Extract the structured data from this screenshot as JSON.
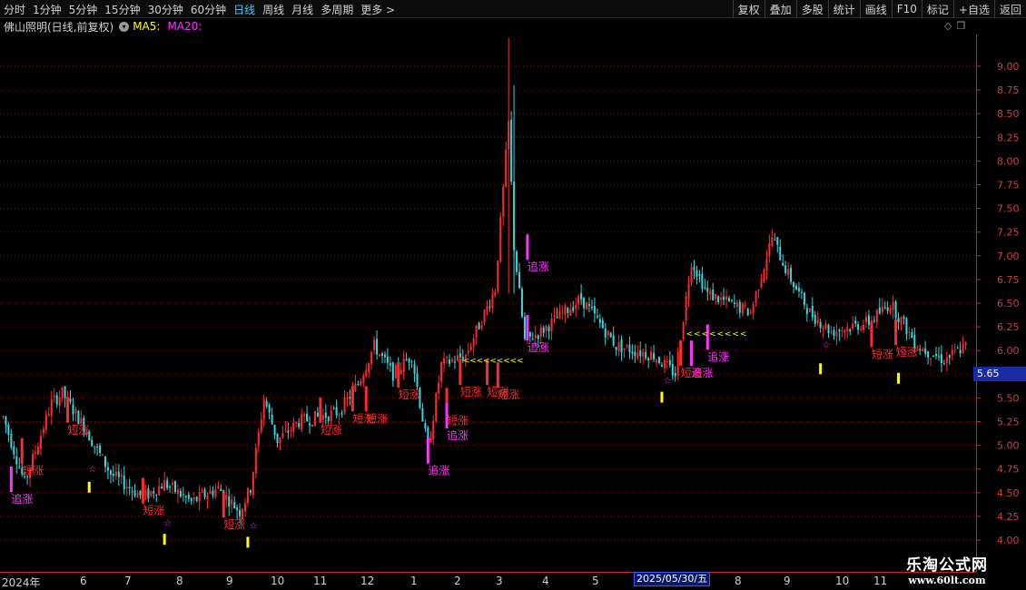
{
  "toolbar": {
    "periods": [
      "分时",
      "1分钟",
      "5分钟",
      "15分钟",
      "30分钟",
      "60分钟",
      "日线",
      "周线",
      "月线",
      "多周期",
      "更多 >"
    ],
    "active_period": "日线",
    "actions": [
      "复权",
      "叠加",
      "多股",
      "统计",
      "画线",
      "F10",
      "标记",
      "+自选",
      "返回"
    ]
  },
  "infobar": {
    "title": "佛山照明(日线,前复权)",
    "ma5_label": "MA5:",
    "ma20_label": "MA20:"
  },
  "current_price_label": "5.65",
  "date_cursor": "2025/05/30/五",
  "watermark": {
    "name": "乐淘公式网",
    "url": "www.60lt.com"
  },
  "colors": {
    "up": "#ff2a2a",
    "down": "#34d8e0",
    "signal_magenta": "#ff33ff",
    "signal_yellow": "#ffff00",
    "grid": "#7a1010"
  },
  "chart_data": {
    "type": "candlestick",
    "y_ticks": [
      "9.00",
      "8.75",
      "8.50",
      "8.25",
      "8.00",
      "7.75",
      "7.50",
      "7.25",
      "7.00",
      "6.75",
      "6.50",
      "6.25",
      "6.00",
      "5.75",
      "5.50",
      "5.25",
      "5.00",
      "4.75",
      "4.50",
      "4.25",
      "4.00"
    ],
    "ylim": [
      3.9,
      9.3
    ],
    "x_labels": [
      "2024年",
      "6",
      "7",
      "8",
      "9",
      "10",
      "11",
      "12",
      "1",
      "2",
      "3",
      "4",
      "5",
      "2025/05/30/五",
      "8",
      "9",
      "10",
      "11"
    ],
    "anchors": [
      [
        0,
        5.3
      ],
      [
        8,
        4.6
      ],
      [
        18,
        5.45
      ],
      [
        22,
        5.55
      ],
      [
        30,
        5.2
      ],
      [
        40,
        4.7
      ],
      [
        52,
        4.45
      ],
      [
        60,
        4.6
      ],
      [
        70,
        4.4
      ],
      [
        80,
        4.55
      ],
      [
        88,
        4.3
      ],
      [
        92,
        4.55
      ],
      [
        97,
        5.5
      ],
      [
        102,
        5.05
      ],
      [
        110,
        5.25
      ],
      [
        125,
        5.35
      ],
      [
        132,
        5.65
      ],
      [
        138,
        6.05
      ],
      [
        145,
        5.75
      ],
      [
        152,
        5.95
      ],
      [
        158,
        4.95
      ],
      [
        163,
        5.85
      ],
      [
        172,
        5.95
      ],
      [
        183,
        6.65
      ],
      [
        188,
        8.4
      ],
      [
        190,
        7.1
      ],
      [
        194,
        6.1
      ],
      [
        200,
        6.2
      ],
      [
        215,
        6.55
      ],
      [
        228,
        6.05
      ],
      [
        242,
        5.95
      ],
      [
        250,
        5.75
      ],
      [
        256,
        6.95
      ],
      [
        262,
        6.6
      ],
      [
        278,
        6.4
      ],
      [
        286,
        7.2
      ],
      [
        292,
        6.8
      ],
      [
        300,
        6.4
      ],
      [
        308,
        6.2
      ],
      [
        322,
        6.3
      ],
      [
        330,
        6.5
      ],
      [
        340,
        6.05
      ],
      [
        350,
        5.9
      ],
      [
        358,
        6.05
      ]
    ],
    "signal_labels": [
      {
        "text": "追涨",
        "x": 3,
        "price": 4.45,
        "color": "#ff33ff"
      },
      {
        "text": "短涨",
        "x": 7,
        "price": 4.75,
        "color": "#ff2a2a"
      },
      {
        "text": "短涨",
        "x": 24,
        "price": 5.18,
        "color": "#ff2a2a"
      },
      {
        "text": "短涨",
        "x": 52,
        "price": 4.33,
        "color": "#ff2a2a"
      },
      {
        "text": "短涨",
        "x": 82,
        "price": 4.18,
        "color": "#ff2a2a"
      },
      {
        "text": "短涨",
        "x": 118,
        "price": 5.18,
        "color": "#ff2a2a"
      },
      {
        "text": "短涨",
        "x": 130,
        "price": 5.3,
        "color": "#ff2a2a"
      },
      {
        "text": "短涨",
        "x": 135,
        "price": 5.3,
        "color": "#ff2a2a"
      },
      {
        "text": "短涨",
        "x": 147,
        "price": 5.55,
        "color": "#ff2a2a"
      },
      {
        "text": "追涨",
        "x": 158,
        "price": 4.75,
        "color": "#ff33ff"
      },
      {
        "text": "短涨",
        "x": 165,
        "price": 5.28,
        "color": "#ff2a2a"
      },
      {
        "text": "追涨",
        "x": 165,
        "price": 5.12,
        "color": "#ff33ff"
      },
      {
        "text": "短涨",
        "x": 170,
        "price": 5.58,
        "color": "#ff2a2a"
      },
      {
        "text": "短涨",
        "x": 180,
        "price": 5.58,
        "color": "#ff2a2a"
      },
      {
        "text": "短涨",
        "x": 184,
        "price": 5.55,
        "color": "#ff2a2a"
      },
      {
        "text": "追涨",
        "x": 195,
        "price": 6.05,
        "color": "#ff33ff"
      },
      {
        "text": "追涨",
        "x": 195,
        "price": 6.9,
        "color": "#ff33ff"
      },
      {
        "text": "短涨",
        "x": 252,
        "price": 5.78,
        "color": "#ff2a2a"
      },
      {
        "text": "追涨",
        "x": 256,
        "price": 5.78,
        "color": "#ff33ff"
      },
      {
        "text": "追涨",
        "x": 262,
        "price": 5.95,
        "color": "#ff33ff"
      },
      {
        "text": "短涨",
        "x": 323,
        "price": 5.98,
        "color": "#ff2a2a"
      },
      {
        "text": "短涨",
        "x": 332,
        "price": 6.0,
        "color": "#ff2a2a"
      }
    ],
    "stars": [
      {
        "x": 33,
        "price": 4.72
      },
      {
        "x": 61,
        "price": 4.15
      },
      {
        "x": 93,
        "price": 4.12
      },
      {
        "x": 159,
        "price": 5.05
      },
      {
        "x": 247,
        "price": 5.65
      },
      {
        "x": 306,
        "price": 6.03
      },
      {
        "x": 335,
        "price": 5.95
      }
    ],
    "yellow_bars": [
      {
        "x": 32,
        "price": 4.5
      },
      {
        "x": 60,
        "price": 3.95
      },
      {
        "x": 91,
        "price": 3.92
      },
      {
        "x": 245,
        "price": 5.45
      },
      {
        "x": 304,
        "price": 5.75
      },
      {
        "x": 333,
        "price": 5.65
      }
    ],
    "arrow_rows": [
      {
        "x_start": 171,
        "x_end": 191,
        "price": 5.87,
        "count": 9
      },
      {
        "x_start": 254,
        "x_end": 274,
        "price": 6.15,
        "count": 8
      }
    ]
  }
}
